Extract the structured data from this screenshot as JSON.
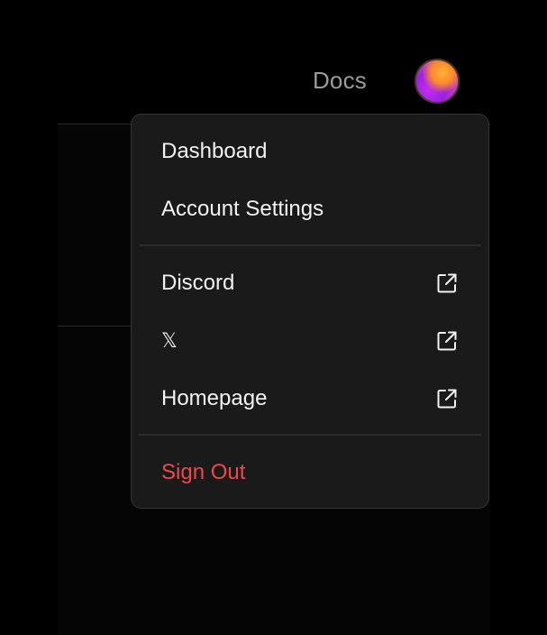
{
  "header": {
    "docs_label": "Docs"
  },
  "menu": {
    "primary": [
      {
        "label": "Dashboard"
      },
      {
        "label": "Account Settings"
      }
    ],
    "external": [
      {
        "label": "Discord",
        "icon": "external-link-icon"
      },
      {
        "label": "𝕏",
        "icon": "external-link-icon"
      },
      {
        "label": "Homepage",
        "icon": "external-link-icon"
      }
    ],
    "sign_out_label": "Sign Out"
  },
  "colors": {
    "menu_background": "#1a1a1a",
    "text": "#f2f2f2",
    "danger": "#f04848",
    "muted": "#9a9a9a"
  }
}
